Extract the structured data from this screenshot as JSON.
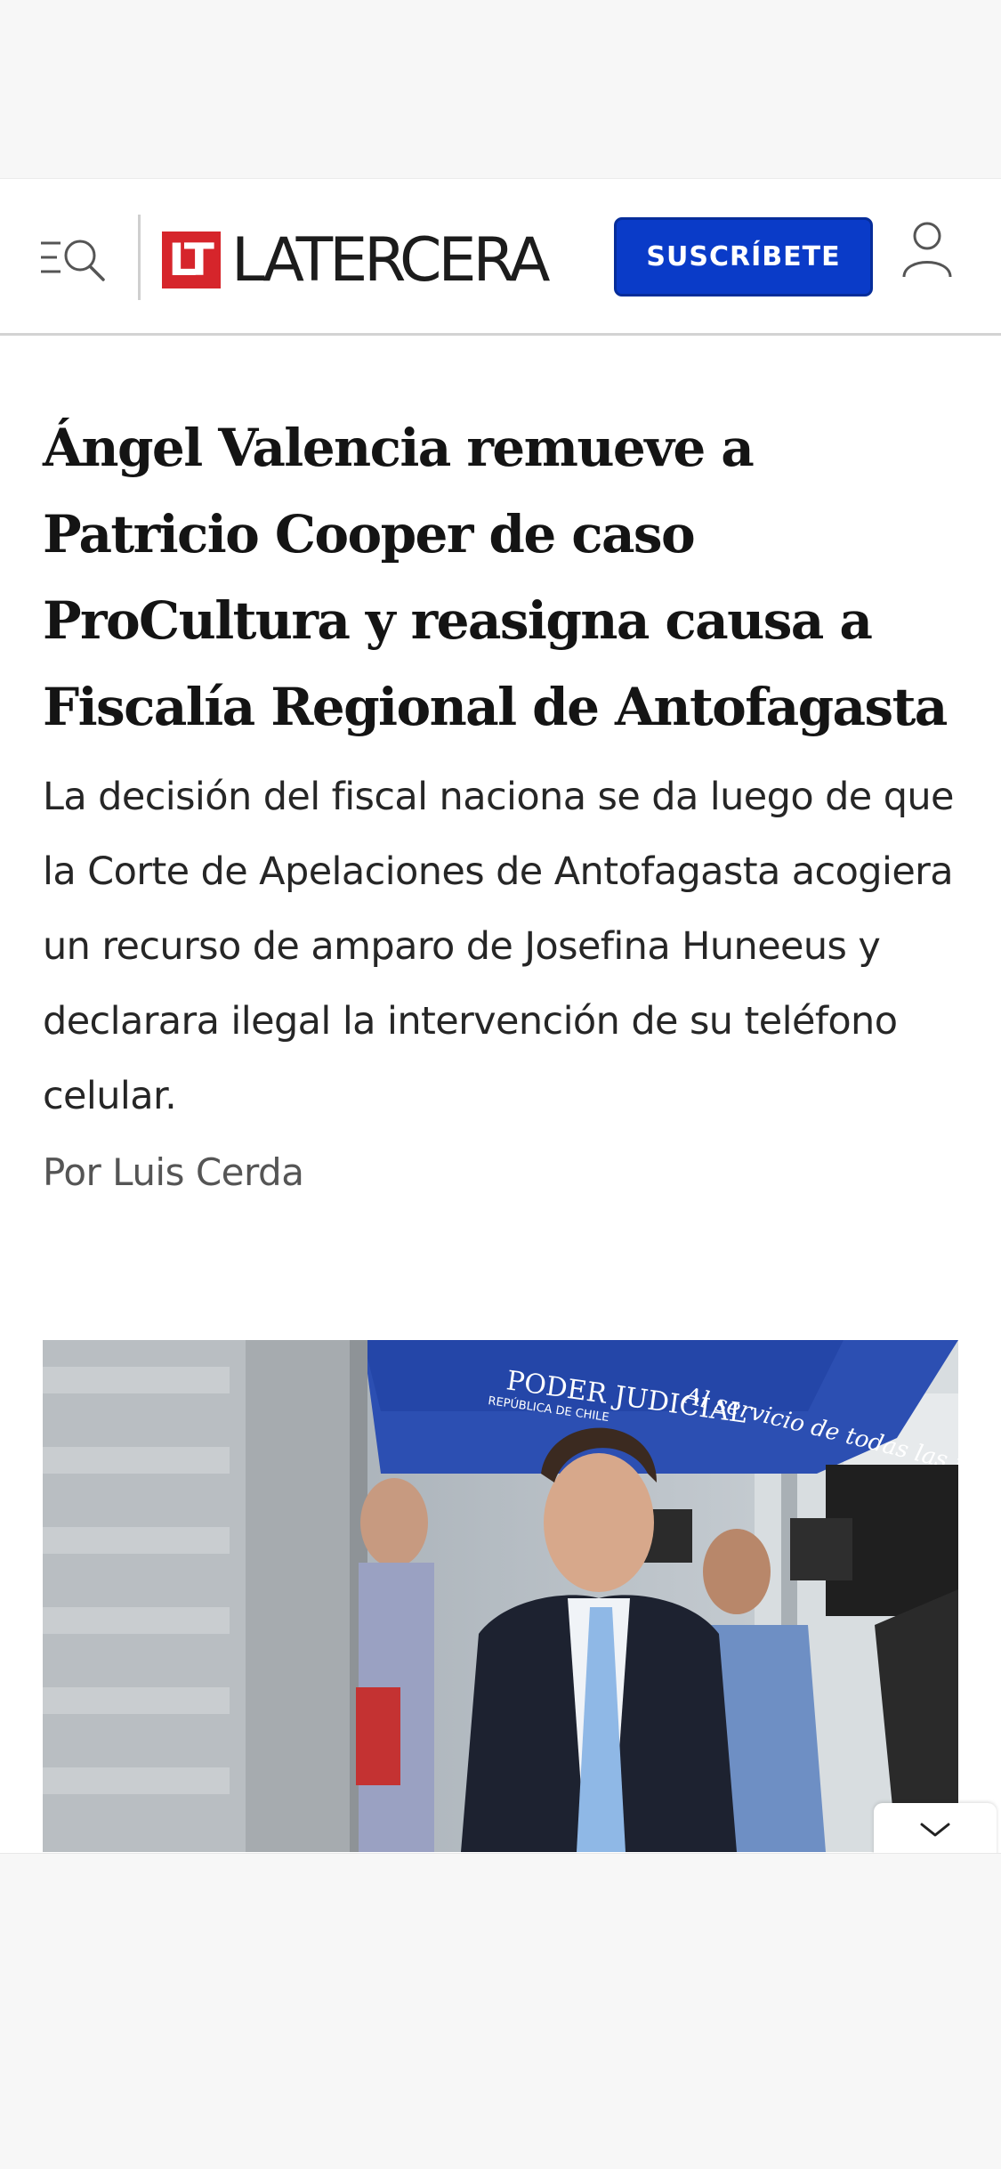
{
  "ads": {
    "top_banner": "",
    "bottom_banner": ""
  },
  "header": {
    "menu_icon": "menu-search-icon",
    "logo_mark": "LT",
    "logo_text": "LATERCERA",
    "subscribe_label": "SUSCRÍBETE",
    "user_icon": "user-icon",
    "colors": {
      "brand_red": "#d6252b",
      "subscribe_blue": "#0a3bc8"
    }
  },
  "article": {
    "headline": "Ángel Valencia remueve a Patricio Cooper de caso ProCultura y reasigna causa a Fiscalía Regional de Antofagasta",
    "lead": "La decisión del fiscal naciona se da luego de que la Corte de Apelaciones de Antofagasta acogiera un recurso de amparo de Josefina Huneeus y declarara ilegal la intervención de su teléfono celular.",
    "byline_prefix": "Por",
    "author": "Luis Cerda",
    "photo": {
      "tent_text": "PODER JUDICIAL",
      "tent_subtext": "REPÚBLICA DE CHILE",
      "tent_slogan": "Al servicio de todas las p"
    }
  },
  "collapse_icon": "chevron-down-icon"
}
